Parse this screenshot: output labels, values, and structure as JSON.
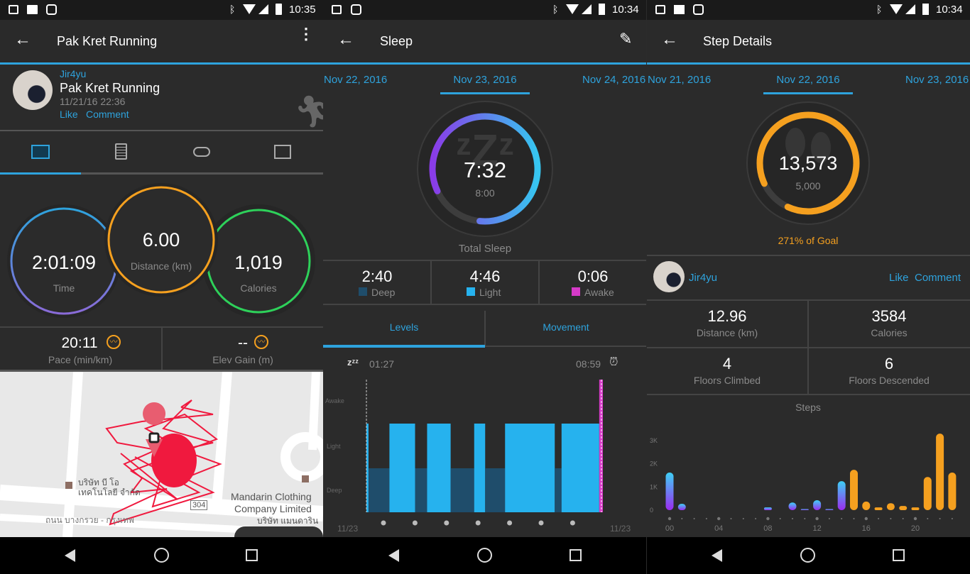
{
  "colors": {
    "accent": "#2ea3dd",
    "orange": "#f5a01f",
    "green": "#2ed15a",
    "deep": "#1f4d6b",
    "light": "#26b2ee",
    "awake": "#d63ac8",
    "track": "#e8213f"
  },
  "activity": {
    "status_time": "10:35",
    "title": "Pak Kret Running",
    "user": "Jir4yu",
    "activity_name": "Pak Kret Running",
    "datetime": "11/21/16 22:36",
    "like": "Like",
    "comment": "Comment",
    "tabs": [
      "stats-icon",
      "details-icon",
      "laps-icon",
      "chart-icon"
    ],
    "active_tab": 0,
    "time": {
      "value": "2:01:09",
      "label": "Time"
    },
    "distance": {
      "value": "6.00",
      "label": "Distance (km)"
    },
    "calories": {
      "value": "1,019",
      "label": "Calories"
    },
    "pace": {
      "value": "20:11",
      "label": "Pace (min/km)"
    },
    "elev": {
      "value": "--",
      "label": "Elev Gain (m)"
    },
    "map": {
      "poi1": "บริษัท บี โอ",
      "poi1b": "เทคโนโลยี จำกัด",
      "poi2": "Mandarin Clothing",
      "poi2b": "Company Limited",
      "poi2c": "บริษัท แมนดาริน",
      "road": "ถนน บางกรวย - กรุงเทพ",
      "route_no": "304"
    }
  },
  "sleep": {
    "status_time": "10:34",
    "title": "Sleep",
    "dates": [
      "Nov 22, 2016",
      "Nov 23, 2016",
      "Nov 24, 2016"
    ],
    "total": "7:32",
    "goal": "8:00",
    "progress": 0.94,
    "total_label": "Total Sleep",
    "stats": [
      {
        "value": "2:40",
        "label": "Deep"
      },
      {
        "value": "4:46",
        "label": "Light"
      },
      {
        "value": "0:06",
        "label": "Awake"
      }
    ],
    "tabs": [
      "Levels",
      "Movement"
    ],
    "active_tab": 0,
    "start": "01:27",
    "end": "08:59",
    "date_left": "11/23",
    "date_right": "11/23"
  },
  "steps": {
    "status_time": "10:34",
    "title": "Step Details",
    "dates": [
      "Nov 21, 2016",
      "Nov 22, 2016",
      "Nov 23, 2016"
    ],
    "total": "13,573",
    "goal": "5,000",
    "progress": 1.0,
    "goal_text": "271% of Goal",
    "user": "Jir4yu",
    "like": "Like",
    "comment": "Comment",
    "stats": [
      {
        "value": "12.96",
        "label": "Distance (km)"
      },
      {
        "value": "3584",
        "label": "Calories"
      },
      {
        "value": "4",
        "label": "Floors Climbed"
      },
      {
        "value": "6",
        "label": "Floors Descended"
      }
    ]
  },
  "chart_data": [
    {
      "type": "bar",
      "title": "Steps",
      "x": [
        0,
        1,
        2,
        3,
        4,
        5,
        6,
        7,
        8,
        9,
        10,
        11,
        12,
        13,
        14,
        15,
        16,
        17,
        18,
        19,
        20,
        21,
        22,
        23
      ],
      "values": [
        1620,
        270,
        0,
        0,
        0,
        0,
        0,
        0,
        120,
        0,
        330,
        20,
        430,
        30,
        1250,
        1740,
        370,
        120,
        300,
        180,
        120,
        1430,
        3300,
        1620
      ],
      "goal_reached_from_hour": 15,
      "xtick_labels": [
        "00",
        "04",
        "08",
        "12",
        "16",
        "20"
      ],
      "ytick_labels": [
        "0",
        "1K",
        "2K",
        "3K"
      ],
      "ylim": [
        0,
        3500
      ]
    },
    {
      "type": "timeline",
      "levels": [
        "Deep",
        "Light",
        "Awake"
      ],
      "segments": [
        {
          "start": "01:27",
          "end": "01:31",
          "level": "Light"
        },
        {
          "start": "01:31",
          "end": "02:11",
          "level": "Deep"
        },
        {
          "start": "02:11",
          "end": "03:00",
          "level": "Light"
        },
        {
          "start": "03:00",
          "end": "03:23",
          "level": "Deep"
        },
        {
          "start": "03:23",
          "end": "04:08",
          "level": "Light"
        },
        {
          "start": "04:08",
          "end": "04:53",
          "level": "Deep"
        },
        {
          "start": "04:53",
          "end": "05:14",
          "level": "Light"
        },
        {
          "start": "05:14",
          "end": "05:52",
          "level": "Deep"
        },
        {
          "start": "05:52",
          "end": "07:27",
          "level": "Light"
        },
        {
          "start": "07:27",
          "end": "07:40",
          "level": "Deep"
        },
        {
          "start": "07:40",
          "end": "08:52",
          "level": "Light"
        },
        {
          "start": "08:52",
          "end": "08:59",
          "level": "Awake"
        }
      ]
    }
  ]
}
